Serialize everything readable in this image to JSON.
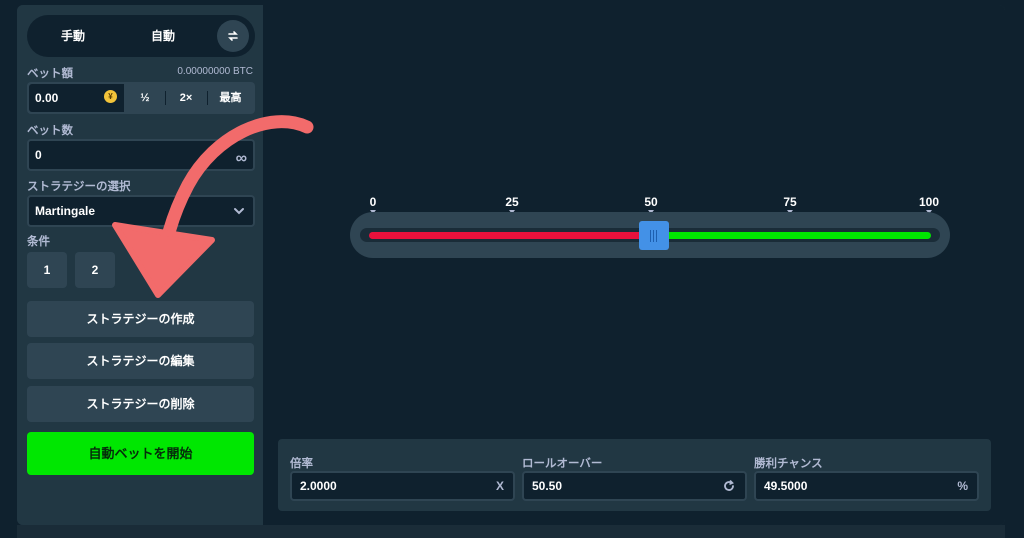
{
  "mode": {
    "manual_label": "手動",
    "auto_label": "自動",
    "swap_icon": "swap-arrows-icon"
  },
  "bet_amount": {
    "label": "ベット額",
    "btc_value": "0.00000000 BTC",
    "value": "0.00",
    "currency_symbol": "¥",
    "half_label": "½",
    "double_label": "2×",
    "max_label": "最高"
  },
  "bet_count": {
    "label": "ベット数",
    "value": "0",
    "icon": "infinity-icon"
  },
  "strategy": {
    "label": "ストラテジーの選択",
    "selected": "Martingale"
  },
  "conditions": {
    "label": "条件",
    "items": [
      "1",
      "2"
    ]
  },
  "actions": {
    "create_label": "ストラテジーの作成",
    "edit_label": "ストラテジーの編集",
    "delete_label": "ストラテジーの削除",
    "start_label": "自動ベットを開始"
  },
  "slider": {
    "ticks": [
      "0",
      "25",
      "50",
      "75",
      "100"
    ],
    "value": 50.5,
    "min": 0,
    "max": 100,
    "lose_color": "#e9113c",
    "win_color": "#00e701"
  },
  "stats": {
    "multiplier_label": "倍率",
    "multiplier_value": "2.0000",
    "multiplier_suffix": "X",
    "rollover_label": "ロールオーバー",
    "rollover_value": "50.50",
    "rollover_icon": "refresh-icon",
    "win_chance_label": "勝利チャンス",
    "win_chance_value": "49.5000",
    "win_chance_suffix": "%"
  },
  "colors": {
    "background": "#0f212e",
    "panel": "#213743",
    "accent_green": "#00e701",
    "handle_blue": "#4391e7",
    "annotation_arrow": "#f26b6b"
  }
}
